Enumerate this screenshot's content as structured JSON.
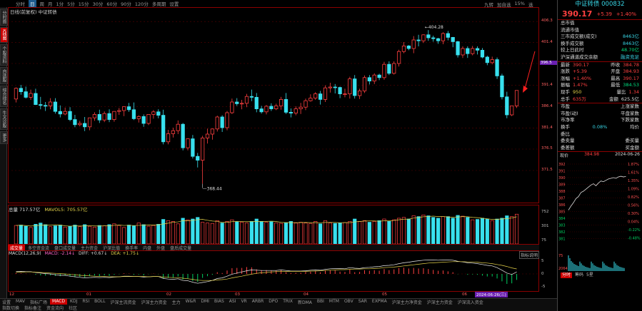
{
  "toolbar": {
    "items": [
      "分时",
      "日",
      "周",
      "月",
      "1分",
      "5分",
      "15分",
      "30分",
      "60分",
      "90分",
      "120分",
      "多周期",
      "设置"
    ],
    "selected": 1,
    "right": [
      "九转",
      "加自选",
      "15%",
      "选"
    ]
  },
  "left_tabs": [
    "分时图",
    "K线图",
    "个股资料",
    "自选股",
    "综合排名",
    "牛叉诊股",
    "更多"
  ],
  "chart_caption": "日线(前复权)  中证转债",
  "price_axis": [
    "406.3",
    "401.4",
    "396.5",
    "391.4",
    "386.4",
    "381.4",
    "376.5",
    "371.5"
  ],
  "price_marker": "396.5",
  "annotations": {
    "high": "404.28",
    "low": "368.44"
  },
  "volume_info": {
    "label": "总量",
    "total": "717.57亿",
    "mavol5": "MAVOL5: 705.57亿"
  },
  "volume_axis": [
    "752",
    "301",
    "75"
  ],
  "vol_tabs": [
    "成交量",
    "多空资金流",
    "盘口成交量",
    "主力资金",
    "沪深比值",
    "换手率",
    "内盘",
    "外盘",
    "盘后成交量"
  ],
  "macd_info": {
    "name": "MACD(12,26,9)",
    "macd": "MACD: -2.14↓",
    "diff": "DIFF: +0.67↓",
    "dea": "DEA: +1.75↓",
    "btn": "指标说明"
  },
  "macd_axis": [
    "5",
    "0",
    "-5"
  ],
  "date_axis": [
    "12",
    "01",
    "02",
    "03",
    "04",
    "05",
    "06"
  ],
  "date_hl": "2024-06-26(三)",
  "ind_tabs": [
    "设置",
    "MAV",
    "指标广场",
    "MACD",
    "KDJ",
    "RSI",
    "BOLL",
    "沪深主流资金",
    "沪深主力资金",
    "主力",
    "W&R",
    "DMI",
    "BIAS",
    "ASI",
    "VR",
    "ARBR",
    "DPO",
    "TRIX",
    "新DMA",
    "BBI",
    "MTM",
    "OBV",
    "SAR",
    "EXPMA",
    "沪深主力净资金",
    "沪深主力资金",
    "沪深流入资金"
  ],
  "ind_tab_sel": 3,
  "bottom_tabs": [
    "指数切换",
    "指标备注",
    "资金流向",
    "社区"
  ],
  "quote": {
    "title": "中证转债 000832",
    "price": "390.17",
    "chg": "+5.39",
    "pct": "+1.40%",
    "rows1": [
      [
        "总市值",
        ""
      ],
      [
        "流通市值",
        ""
      ],
      [
        "三市成交额(成交)",
        "8463亿"
      ],
      [
        "换手成交额",
        "8463亿"
      ],
      [
        "较上日此时",
        "48.70亿"
      ],
      [
        "沪深通道成交余额",
        "融资充足"
      ]
    ],
    "rows2": [
      [
        "最新",
        "390.17",
        "昨收",
        "384.78"
      ],
      [
        "涨跌",
        "+5.39",
        "开盘",
        "384.93"
      ],
      [
        "涨幅",
        "+1.40%",
        "最高",
        "390.17"
      ],
      [
        "振幅",
        "1.47%",
        "最低",
        "384.53"
      ],
      [
        "现手",
        "950",
        "量比",
        "1.34"
      ],
      [
        "总手",
        "635万",
        "金额",
        "625.5亿"
      ]
    ],
    "rows3": [
      [
        "市盈",
        "上涨家数"
      ],
      [
        "市盈(动)",
        "平盘家数"
      ],
      [
        "市净率",
        "下跌家数"
      ],
      [
        "换手",
        "0.08%",
        "均价"
      ],
      [
        "委比",
        ""
      ],
      [
        "委卖量",
        "委买量"
      ],
      [
        "委差额",
        "买金额"
      ]
    ],
    "intraday_caption": [
      "现价",
      "384.98",
      "2024-06-26"
    ],
    "intraday_left": [
      "392",
      "391",
      "390",
      "389",
      "388",
      "387",
      "386",
      "385",
      "384",
      "383",
      "382",
      "381"
    ],
    "intraday_right": [
      "1.87%",
      "1.61%",
      "1.35%",
      "1.09%",
      "0.82%",
      "0.56%",
      "0.30%",
      "0.04%",
      "-0.22%",
      "-0.48%"
    ],
    "intraday_vol": [
      "75",
      "2064"
    ],
    "bottom": [
      "分时",
      "筹码",
      "5星"
    ]
  },
  "chart_data": {
    "type": "candlestick",
    "open": [
      388.2,
      390.7,
      389.9,
      388.6,
      389.5,
      386.9,
      386.7,
      386.6,
      387.5,
      385.3,
      384.7,
      385.3,
      383.4,
      382.2,
      382.5,
      381.7,
      383.8,
      384.6,
      383.3,
      384.8,
      383.4,
      385.3,
      385.5,
      386.4,
      385.7,
      383.6,
      384.1,
      382.5,
      384.6,
      385.2,
      384.4,
      378.2,
      380.1,
      380.8,
      382.3,
      376.8,
      378.9,
      374.8,
      373.9,
      379.1,
      380.0,
      381.2,
      384.0,
      381.5,
      385.0,
      387.5,
      387.1,
      387.2,
      388.8,
      388.6,
      385.9,
      385.2,
      386.5,
      385.9,
      386.6,
      388.1,
      385.1,
      384.9,
      385.9,
      386.3,
      387.8,
      388.4,
      389.4,
      388.1,
      390.8,
      391.0,
      390.9,
      389.4,
      389.4,
      392.9,
      389.0,
      390.1,
      393.2,
      392.4,
      393.8,
      393.2,
      396.3,
      394.2,
      396.5,
      399.3,
      400.6,
      400.0,
      402.0,
      401.8,
      403.2,
      402.5,
      402.3,
      401.8,
      403.5,
      402.6,
      401.6,
      398.5,
      400.0,
      398.8,
      400.0,
      399.6,
      398.0,
      396.7,
      397.4,
      393.6,
      388.7,
      384.5,
      386.6
    ],
    "high": [
      390.9,
      391.5,
      391.1,
      390.4,
      390.6,
      388.7,
      387.5,
      388.4,
      388.4,
      386.7,
      386.2,
      386.3,
      384.5,
      383.1,
      384.0,
      383.7,
      385.1,
      385.7,
      385.3,
      385.8,
      385.3,
      386.1,
      386.2,
      387.3,
      387.4,
      384.4,
      384.6,
      384.6,
      385.6,
      385.8,
      385.7,
      381.0,
      381.5,
      383.2,
      382.6,
      378.9,
      379.8,
      375.6,
      379.6,
      381.3,
      381.3,
      384.3,
      384.4,
      385.4,
      388.3,
      388.4,
      388.0,
      389.4,
      390.4,
      389.6,
      386.6,
      386.8,
      387.2,
      387.1,
      388.7,
      389.6,
      386.0,
      386.5,
      387.3,
      388.3,
      389.3,
      389.8,
      390.1,
      391.4,
      392.0,
      391.7,
      391.1,
      390.6,
      393.4,
      393.8,
      390.6,
      393.7,
      393.8,
      394.2,
      394.1,
      396.9,
      397.0,
      397.0,
      399.7,
      401.5,
      400.8,
      402.9,
      403.2,
      403.3,
      404.3,
      403.0,
      402.5,
      403.8,
      404.1,
      402.7,
      401.8,
      400.5,
      400.5,
      400.6,
      400.5,
      400.1,
      398.3,
      398.1,
      397.9,
      394.1,
      389.9,
      386.6,
      390.2
    ],
    "low": [
      387.4,
      389.2,
      388.3,
      388.0,
      386.8,
      385.8,
      385.4,
      385.8,
      384.8,
      383.9,
      384.4,
      383.0,
      381.6,
      381.8,
      380.7,
      380.9,
      383.1,
      382.6,
      382.8,
      382.8,
      382.9,
      384.5,
      384.2,
      385.2,
      383.3,
      382.7,
      381.7,
      382.1,
      383.6,
      383.7,
      377.6,
      377.6,
      379.2,
      380.0,
      376.2,
      376.2,
      374.3,
      372.2,
      368.4,
      377.8,
      378.7,
      380.6,
      380.5,
      380.9,
      384.7,
      386.6,
      385.8,
      386.3,
      387.7,
      385.1,
      384.8,
      384.6,
      385.4,
      385.6,
      385.7,
      384.7,
      383.9,
      384.4,
      384.7,
      385.6,
      387.6,
      388.0,
      386.9,
      387.5,
      389.7,
      389.5,
      388.4,
      388.6,
      388.3,
      388.3,
      388.2,
      389.6,
      391.6,
      391.7,
      392.6,
      392.7,
      393.8,
      393.9,
      395.8,
      398.9,
      399.6,
      398.9,
      400.5,
      401.3,
      401.8,
      401.6,
      401.1,
      401.0,
      401.9,
      400.3,
      397.9,
      397.8,
      397.8,
      398.4,
      398.6,
      397.7,
      396.1,
      396.3,
      392.9,
      388.1,
      383.7,
      384.2,
      386.1
    ],
    "close": [
      390.7,
      389.9,
      388.6,
      389.5,
      386.9,
      386.7,
      386.6,
      387.5,
      385.3,
      384.7,
      385.3,
      383.4,
      382.2,
      382.5,
      381.7,
      383.8,
      384.6,
      383.3,
      384.8,
      383.4,
      385.3,
      385.5,
      386.4,
      385.7,
      383.6,
      384.1,
      382.5,
      384.6,
      385.2,
      384.4,
      378.2,
      380.1,
      380.8,
      382.3,
      376.8,
      378.9,
      374.8,
      373.9,
      379.1,
      380.0,
      381.2,
      384.0,
      381.5,
      385.0,
      387.5,
      387.1,
      387.2,
      388.8,
      388.6,
      385.9,
      385.2,
      386.5,
      385.9,
      386.6,
      388.1,
      385.1,
      384.9,
      385.9,
      386.3,
      387.8,
      388.4,
      389.4,
      388.1,
      390.8,
      391.0,
      390.9,
      389.4,
      389.4,
      392.9,
      389.0,
      390.1,
      393.2,
      392.4,
      393.8,
      393.2,
      396.3,
      394.2,
      396.5,
      399.3,
      400.6,
      400.0,
      402.0,
      401.8,
      403.2,
      402.5,
      402.3,
      401.8,
      403.5,
      402.6,
      401.6,
      398.5,
      400.0,
      398.8,
      400.0,
      399.6,
      398.0,
      396.7,
      397.4,
      393.6,
      388.7,
      384.5,
      386.6,
      390.2
    ],
    "volume": [
      460,
      470,
      440,
      410,
      490,
      520,
      480,
      430,
      450,
      470,
      420,
      440,
      470,
      430,
      480,
      440,
      420,
      460,
      450,
      480,
      500,
      460,
      410,
      470,
      450,
      520,
      480,
      440,
      460,
      490,
      610,
      580,
      560,
      500,
      640,
      600,
      620,
      660,
      540,
      520,
      510,
      580,
      520,
      560,
      600,
      550,
      540,
      520,
      560,
      620,
      560,
      540,
      550,
      520,
      510,
      530,
      560,
      520,
      540,
      520,
      510,
      560,
      500,
      580,
      520,
      510,
      520,
      530,
      560,
      620,
      560,
      580,
      540,
      560,
      580,
      620,
      560,
      600,
      640,
      660,
      620,
      700,
      680,
      720,
      700,
      660,
      640,
      680,
      680,
      640,
      710,
      690,
      660,
      600,
      610,
      640,
      620,
      580,
      620,
      640,
      700,
      680,
      740
    ],
    "macd_hist": [
      0.3,
      0.2,
      0.1,
      0.0,
      -0.3,
      -0.5,
      -0.6,
      -0.5,
      -0.7,
      -0.8,
      -0.6,
      -0.9,
      -1.1,
      -1.0,
      -1.2,
      -0.8,
      -0.6,
      -0.8,
      -0.5,
      -0.7,
      -0.3,
      -0.1,
      0.2,
      0.1,
      -0.3,
      -0.2,
      -0.5,
      -0.1,
      0.1,
      -0.1,
      -1.5,
      -1.4,
      -1.3,
      -0.9,
      -2.0,
      -1.6,
      -2.5,
      -2.8,
      -1.4,
      -0.8,
      -0.3,
      0.6,
      0.3,
      1.2,
      2.0,
      2.1,
      2.1,
      2.4,
      2.3,
      1.6,
      1.3,
      1.3,
      1.1,
      1.1,
      1.3,
      0.6,
      0.3,
      0.4,
      0.4,
      0.7,
      0.8,
      1.0,
      0.6,
      1.2,
      1.3,
      1.2,
      0.8,
      0.7,
      1.5,
      0.6,
      0.7,
      1.3,
      1.1,
      1.3,
      1.1,
      1.7,
      1.3,
      1.6,
      2.1,
      2.2,
      1.9,
      2.1,
      1.9,
      2.0,
      1.7,
      1.4,
      1.1,
      1.2,
      0.9,
      0.6,
      -0.1,
      0.0,
      -0.3,
      -0.2,
      -0.3,
      -0.6,
      -0.9,
      -0.9,
      -1.6,
      -2.6,
      -3.5,
      -3.3,
      -2.1
    ],
    "diff": [
      0.8,
      0.9,
      0.8,
      0.8,
      0.5,
      0.3,
      0.1,
      0.0,
      -0.3,
      -0.5,
      -0.5,
      -0.8,
      -1.0,
      -1.2,
      -1.4,
      -1.3,
      -1.2,
      -1.3,
      -1.2,
      -1.3,
      -1.1,
      -1.0,
      -0.8,
      -0.8,
      -0.9,
      -0.9,
      -1.1,
      -1.0,
      -0.9,
      -0.9,
      -1.6,
      -1.8,
      -1.9,
      -1.7,
      -2.3,
      -2.4,
      -2.9,
      -3.3,
      -3.0,
      -2.7,
      -2.3,
      -1.6,
      -1.4,
      -0.8,
      -0.1,
      0.3,
      0.7,
      1.1,
      1.4,
      1.3,
      1.2,
      1.2,
      1.2,
      1.2,
      1.4,
      1.2,
      1.0,
      1.0,
      1.0,
      1.1,
      1.3,
      1.4,
      1.3,
      1.6,
      1.8,
      1.9,
      1.9,
      1.8,
      2.2,
      2.0,
      1.9,
      2.2,
      2.3,
      2.5,
      2.6,
      2.9,
      3.0,
      3.2,
      3.6,
      3.9,
      4.1,
      4.4,
      4.6,
      4.8,
      4.9,
      4.9,
      4.8,
      4.9,
      4.9,
      4.8,
      4.4,
      4.2,
      3.9,
      3.8,
      3.6,
      3.3,
      3.0,
      2.8,
      2.2,
      1.3,
      0.3,
      -0.2,
      0.7
    ],
    "dea": [
      0.6,
      0.6,
      0.7,
      0.7,
      0.6,
      0.5,
      0.4,
      0.3,
      0.2,
      0.1,
      0.0,
      -0.2,
      -0.3,
      -0.5,
      -0.6,
      -0.7,
      -0.8,
      -0.9,
      -0.9,
      -1.0,
      -1.0,
      -1.0,
      -0.9,
      -0.9,
      -0.9,
      -0.9,
      -0.9,
      -1.0,
      -0.9,
      -0.9,
      -1.1,
      -1.2,
      -1.3,
      -1.3,
      -1.5,
      -1.7,
      -1.9,
      -2.2,
      -2.3,
      -2.3,
      -2.3,
      -2.1,
      -2.0,
      -1.8,
      -1.4,
      -1.1,
      -0.8,
      -0.4,
      -0.1,
      0.2,
      0.4,
      0.5,
      0.7,
      0.8,
      0.9,
      0.9,
      0.9,
      0.9,
      0.9,
      0.9,
      1.0,
      1.0,
      1.1,
      1.2,
      1.3,
      1.4,
      1.5,
      1.5,
      1.6,
      1.7,
      1.7,
      1.8,
      1.8,
      1.9,
      2.0,
      2.2,
      2.3,
      2.4,
      2.6,
      2.8,
      3.0,
      3.2,
      3.4,
      3.6,
      3.8,
      3.9,
      4.0,
      4.1,
      4.2,
      4.3,
      4.3,
      4.3,
      4.2,
      4.2,
      4.1,
      3.9,
      3.8,
      3.6,
      3.3,
      3.0,
      2.6,
      2.1,
      1.75
    ],
    "ma5": [
      389,
      389.3,
      389.5,
      389.4,
      389.1,
      388.3,
      387.7,
      387.4,
      386.6,
      386.2,
      385.9,
      385.2,
      384.7,
      384.0,
      383.4,
      383.1,
      382.9,
      383.1,
      383.6,
      383.9,
      384.3,
      384.5,
      385.0,
      385.3,
      385.3,
      385.1,
      384.7,
      384.5,
      384.4,
      384.2,
      383.0,
      382.5,
      381.8,
      381.1,
      380.4,
      379.9,
      378.8,
      378.2,
      377.7,
      376.9,
      377.4,
      378.7,
      379.6,
      381.4,
      383.2,
      384.1,
      385.3,
      386.0,
      387.8,
      387.8,
      387.5,
      387.3,
      387.2,
      386.6,
      386.5,
      386.3,
      386.1,
      386.1,
      385.9,
      385.9,
      386.6,
      387.6,
      388.0,
      388.9,
      389.5,
      390.1,
      390.1,
      389.9,
      390.7,
      390.3,
      390.2,
      390.7,
      391.7,
      391.7,
      392.5,
      393.9,
      394.3,
      394.8,
      395.9,
      397.4,
      398.1,
      399.7,
      400.7,
      401.5,
      401.9,
      402.1,
      402.2,
      402.9,
      402.8,
      402.0,
      401.2,
      400.4,
      399.3,
      399.3,
      398.8,
      398.4,
      398.6,
      398.0,
      396.6,
      395.3,
      391.5,
      388.6,
      388.2
    ]
  }
}
